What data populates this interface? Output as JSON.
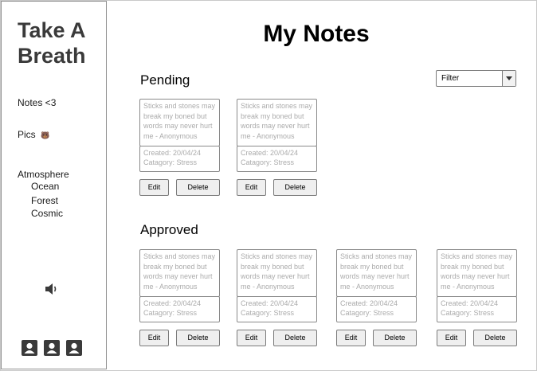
{
  "sidebar": {
    "brand_line1": "Take A",
    "brand_line2": "Breath",
    "notes_label": "Notes <3",
    "pics_label": "Pics",
    "pics_emoji": "🐻",
    "atmosphere_label": "Atmosphere",
    "atmosphere_items": [
      "Ocean",
      "Forest",
      "Cosmic"
    ],
    "speaker_icon": "speaker-icon",
    "user_icons": [
      "user-icon",
      "user-icon",
      "user-icon"
    ]
  },
  "main": {
    "title": "My Notes",
    "filter": {
      "selected": "Filter"
    },
    "pending": {
      "title": "Pending",
      "notes": [
        {
          "text": "Sticks and stones may break my boned but words may never hurt me - Anonymous",
          "created": "Created: 20/04/24",
          "category": "Catagory: Stress",
          "edit_label": "Edit",
          "delete_label": "Delete"
        },
        {
          "text": "Sticks and stones may break my boned but words may never hurt me - Anonymous",
          "created": "Created: 20/04/24",
          "category": "Catagory: Stress",
          "edit_label": "Edit",
          "delete_label": "Delete"
        }
      ]
    },
    "approved": {
      "title": "Approved",
      "notes": [
        {
          "text": "Sticks and stones may break my boned but words may never hurt me - Anonymous",
          "created": "Created: 20/04/24",
          "category": "Catagory: Stress",
          "edit_label": "Edit",
          "delete_label": "Delete"
        },
        {
          "text": "Sticks and stones may break my boned but words may never hurt me - Anonymous",
          "created": "Created: 20/04/24",
          "category": "Catagory: Stress",
          "edit_label": "Edit",
          "delete_label": "Delete"
        },
        {
          "text": "Sticks and stones may break my boned but words may never hurt me - Anonymous",
          "created": "Created: 20/04/24",
          "category": "Catagory: Stress",
          "edit_label": "Edit",
          "delete_label": "Delete"
        },
        {
          "text": "Sticks and stones may break my boned but words may never hurt me - Anonymous",
          "created": "Created: 20/04/24",
          "category": "Catagory: Stress",
          "edit_label": "Edit",
          "delete_label": "Delete"
        }
      ]
    }
  }
}
